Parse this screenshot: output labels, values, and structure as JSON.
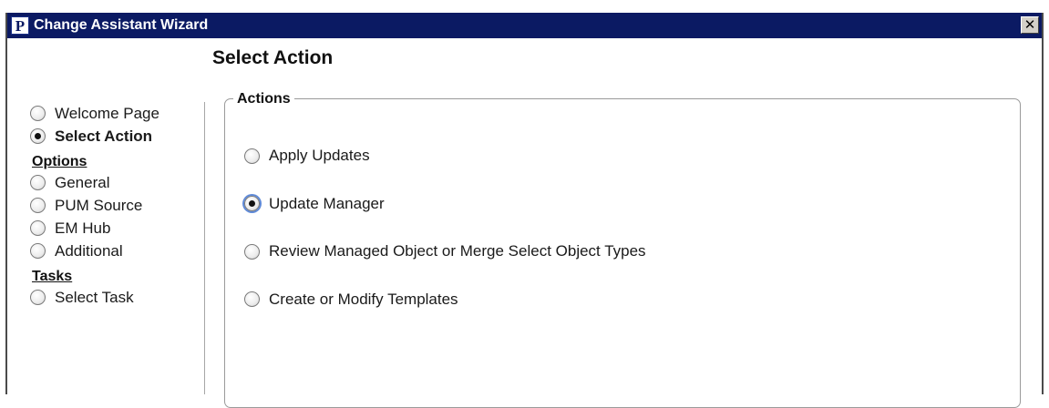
{
  "window": {
    "title": "Change Assistant Wizard",
    "app_icon_letter": "P",
    "close_glyph": "✕"
  },
  "page": {
    "title": "Select Action"
  },
  "nav": {
    "items_top": [
      {
        "label": "Welcome Page",
        "checked": false
      },
      {
        "label": "Select Action",
        "checked": true
      }
    ],
    "options_heading": "Options",
    "options": [
      {
        "label": "General",
        "checked": false
      },
      {
        "label": "PUM Source",
        "checked": false
      },
      {
        "label": "EM Hub",
        "checked": false
      },
      {
        "label": "Additional",
        "checked": false
      }
    ],
    "tasks_heading": "Tasks",
    "tasks": [
      {
        "label": "Select Task",
        "checked": false
      }
    ]
  },
  "actions": {
    "legend": "Actions",
    "items": [
      {
        "label": "Apply Updates",
        "checked": false
      },
      {
        "label": "Update Manager",
        "checked": true
      },
      {
        "label": "Review Managed Object or Merge Select Object Types",
        "checked": false
      },
      {
        "label": "Create or Modify Templates",
        "checked": false
      }
    ]
  },
  "colors": {
    "titlebar": "#0b1a63",
    "focus_ring": "#5f8ad8"
  },
  "icons": {
    "app": "peoplesoft-p-icon",
    "close": "close-icon",
    "radio": "radio-icon"
  }
}
